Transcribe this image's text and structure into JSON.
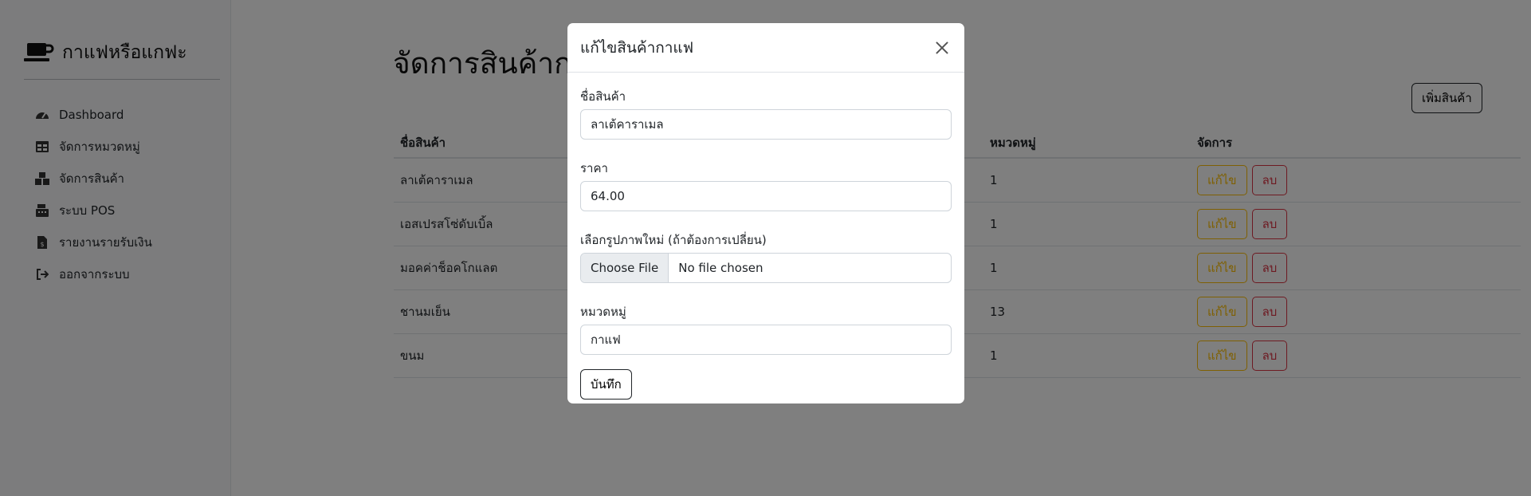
{
  "brand": {
    "title": "กาแฟหรือแกฟะ",
    "icon": "coffee-cup-icon"
  },
  "sidebar": {
    "items": [
      {
        "label": "Dashboard",
        "icon": "gauge-icon"
      },
      {
        "label": "จัดการหมวดหมู่",
        "icon": "table-icon"
      },
      {
        "label": "จัดการสินค้า",
        "icon": "boxes-icon"
      },
      {
        "label": "ระบบ POS",
        "icon": "cash-register-icon"
      },
      {
        "label": "รายงานรายรับเงิน",
        "icon": "invoice-icon"
      },
      {
        "label": "ออกจากระบบ",
        "icon": "sign-out-icon"
      }
    ]
  },
  "main": {
    "title": "จัดการสินค้ากาแฟ",
    "add_button": "เพิ่มสินค้า",
    "table": {
      "headers": {
        "name": "ชื่อสินค้า",
        "category": "หมวดหมู่",
        "actions": "จัดการ"
      },
      "rows": [
        {
          "name": "ลาเต้คาราเมล",
          "category": "1"
        },
        {
          "name": "เอสเปรสโซ่ดับเบิ้ล",
          "category": "1"
        },
        {
          "name": "มอคค่าช็อคโกแลต",
          "category": "1"
        },
        {
          "name": "ชานมเย็น",
          "category": "13"
        },
        {
          "name": "ขนม",
          "category": "1"
        }
      ],
      "edit_label": "แก้ไข",
      "delete_label": "ลบ"
    }
  },
  "modal": {
    "title": "แก้ไขสินค้ากาแฟ",
    "fields": {
      "name_label": "ชื่อสินค้า",
      "name_value": "ลาเต้คาราเมล",
      "price_label": "ราคา",
      "price_value": "64.00",
      "image_label": "เลือกรูปภาพใหม่ (ถ้าต้องการเปลี่ยน)",
      "file_button": "Choose File",
      "file_status": "No file chosen",
      "category_label": "หมวดหมู่",
      "category_value": "กาแฟ"
    },
    "save_button": "บันทึก"
  },
  "colors": {
    "warning": "#ffc107",
    "danger": "#dc3545",
    "backdrop": "rgba(0,0,0,0.5)"
  }
}
